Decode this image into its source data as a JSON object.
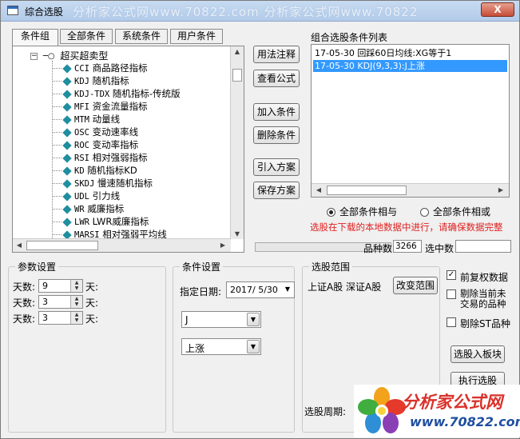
{
  "window": {
    "title": "综合选股",
    "watermark": "分析家公式网www.70822.com  分析家公式网www.70822",
    "close_label": "X"
  },
  "tabs": [
    "条件组",
    "全部条件",
    "系统条件",
    "用户条件"
  ],
  "tree": {
    "root": "超买超卖型",
    "items": [
      {
        "code": "CCI",
        "name": "商品路径指标"
      },
      {
        "code": "KDJ",
        "name": "随机指标"
      },
      {
        "code": "KDJ-TDX",
        "name": "随机指标-传统版"
      },
      {
        "code": "MFI",
        "name": "资金流量指标"
      },
      {
        "code": "MTM",
        "name": "动量线"
      },
      {
        "code": "OSC",
        "name": "变动速率线"
      },
      {
        "code": "ROC",
        "name": "变动率指标"
      },
      {
        "code": "RSI",
        "name": "相对强弱指标"
      },
      {
        "code": "KD",
        "name": "随机指标KD"
      },
      {
        "code": "SKDJ",
        "name": "慢速随机指标"
      },
      {
        "code": "UDL",
        "name": "引力线"
      },
      {
        "code": "WR",
        "name": "威廉指标"
      },
      {
        "code": "LWR",
        "name": "LWR威廉指标"
      },
      {
        "code": "MARSI",
        "name": "相对强弱平均线"
      }
    ]
  },
  "actions": {
    "usage": "用法注释",
    "view_formula": "查看公式",
    "add_condition": "加入条件",
    "delete_condition": "删除条件",
    "import_plan": "引入方案",
    "save_plan": "保存方案"
  },
  "condition_list": {
    "label": "组合选股条件列表",
    "items": [
      {
        "text": "17-05-30 回踩60日均线:XG等于1",
        "selected": false
      },
      {
        "text": "17-05-30 KDJ(9,3,3):J上涨",
        "selected": true
      }
    ]
  },
  "logic": {
    "and_label": "全部条件相与",
    "or_label": "全部条件相或",
    "selected": "and"
  },
  "warning": "选股在下载的本地数据中进行，请确保数据完整",
  "status": {
    "count_label": "品种数",
    "count_value": "3266",
    "selected_label": "选中数",
    "selected_value": ""
  },
  "params": {
    "title": "参数设置",
    "rows": [
      {
        "label": "天数:",
        "value": "9",
        "unit": "天:"
      },
      {
        "label": "天数:",
        "value": "3",
        "unit": "天:"
      },
      {
        "label": "天数:",
        "value": "3",
        "unit": "天:"
      }
    ]
  },
  "conditions": {
    "title": "条件设置",
    "date_label": "指定日期:",
    "date_value": "2017/ 5/30",
    "line_value": "J",
    "op_value": "上涨"
  },
  "range": {
    "title": "选股范围",
    "text": "上证A股 深证A股",
    "change_button": "改变范围",
    "period_label": "选股周期:"
  },
  "options": [
    {
      "label": "前复权数据",
      "checked": true
    },
    {
      "label": "剔除当前未交易的品种",
      "checked": false
    },
    {
      "label": "剔除ST品种",
      "checked": false
    }
  ],
  "buttons": {
    "to_block": "选股入板块",
    "run": "执行选股"
  },
  "logo": {
    "main": "分析家公式网",
    "url": "www.70822.com"
  },
  "colors": {
    "selection": "#3399ff",
    "warning": "#e02020",
    "tree_gem": "#1f8fa0",
    "logo_red": "#d8322b",
    "logo_blue": "#1f4f9f"
  }
}
